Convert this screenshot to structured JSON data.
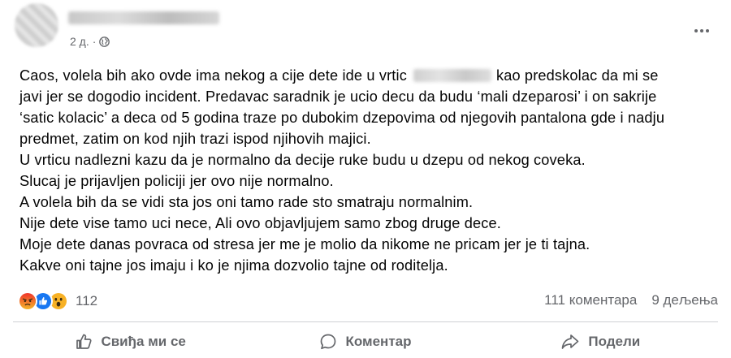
{
  "header": {
    "time": "2 д.",
    "separator": "·",
    "audience_icon": "globe-icon",
    "more_icon": "more-dots-icon"
  },
  "post": {
    "lines": [
      {
        "before": "Caos, volela bih ako ovde ima nekog a cije dete ide u vrtic",
        "after": "kao predskolac da mi se"
      },
      {
        "text": "javi jer se dogodio incident. Predavac saradnik je ucio decu da budu ‘mali dzeparosi’ i on sakrije"
      },
      {
        "text": "‘satic kolacic’ a deca od 5 godina traze po dubokim dzepovima od njegovih pantalona gde i nadju"
      },
      {
        "text": "predmet, zatim on kod njih trazi ispod njihovih majici."
      },
      {
        "text": "U vrticu nadlezni kazu da je normalno da decije ruke budu u dzepu od nekog coveka."
      },
      {
        "text": "Slucaj je prijavljen policiji jer ovo nije normalno."
      },
      {
        "text": "A volela bih da se vidi sta jos oni tamo rade sto smatraju normalnim."
      },
      {
        "text": "Nije dete vise tamo uci nece, Ali ovo objavljujem samo zbog druge dece."
      },
      {
        "text": "Moje dete danas povraca od stresa jer me je molio da nikome ne pricam jer je ti tajna."
      },
      {
        "text": "Kakve oni tajne jos imaju i ko je njima dozvolio tajne od roditelja."
      }
    ]
  },
  "reactions": {
    "icons": [
      "angry-reaction-icon",
      "like-reaction-icon",
      "wow-reaction-icon"
    ],
    "count": "112",
    "comments": "111 коментара",
    "shares": "9 дељења",
    "colors": {
      "angry": "#e9710f",
      "like": "#1877f2",
      "wow": "#f7b125"
    }
  },
  "actions": {
    "like": "Свиђа ми се",
    "comment": "Коментар",
    "share": "Подели"
  }
}
